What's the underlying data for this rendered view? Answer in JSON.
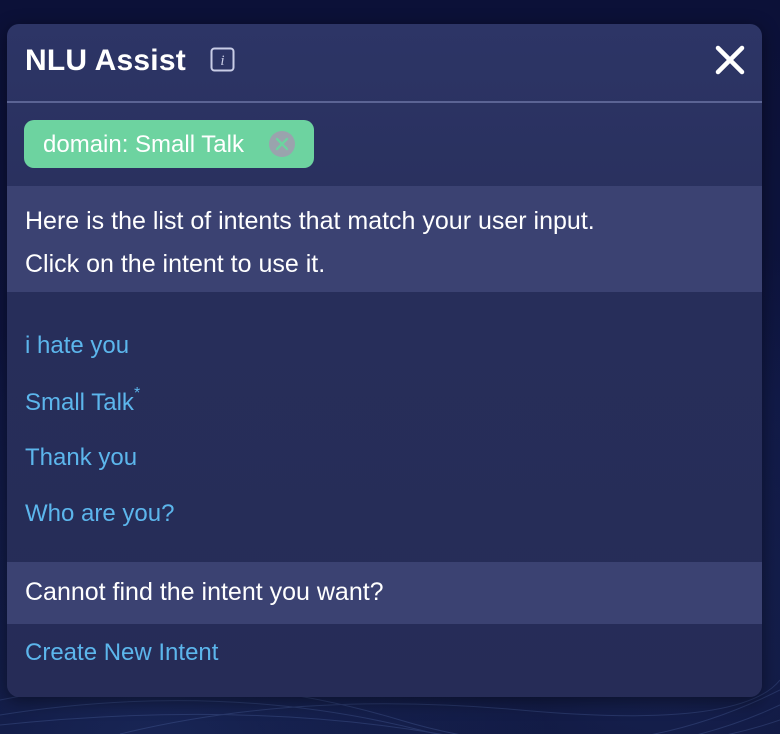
{
  "panel": {
    "title": "NLU Assist",
    "info_icon": "info-icon",
    "close_icon": "close-icon"
  },
  "filter_chip": {
    "label": "domain: Small Talk",
    "remove_icon": "close-circle-icon"
  },
  "prompt": {
    "line1": "Here is the list of intents that match your user input.",
    "line2": "Click on the intent to use it."
  },
  "intents": [
    {
      "label": "i hate you",
      "marker": ""
    },
    {
      "label": "Small Talk",
      "marker": "*"
    },
    {
      "label": "Thank you",
      "marker": ""
    },
    {
      "label": "Who are you?",
      "marker": ""
    }
  ],
  "footer": {
    "question": "Cannot find the intent you want?",
    "create_label": "Create New Intent"
  },
  "colors": {
    "panel_bg": "#2a3160",
    "band_bg": "#3b4272",
    "chip_bg": "#6dd3a0",
    "link": "#5cb6ec",
    "text": "#ffffff"
  }
}
